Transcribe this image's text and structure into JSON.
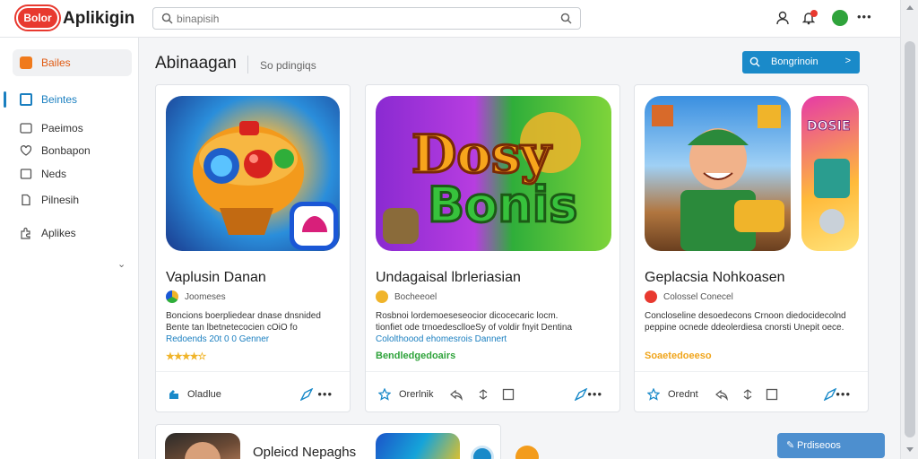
{
  "brand": {
    "badge": "Bolor",
    "name": "Aplikigin"
  },
  "search": {
    "placeholder": "binapisih",
    "value": ""
  },
  "sidebar": {
    "items": [
      {
        "label": "Bailes"
      },
      {
        "label": "Beintes"
      },
      {
        "label": "Paeimos"
      },
      {
        "label": "Bonbapon"
      },
      {
        "label": "Neds"
      },
      {
        "label": "Pilnesih"
      },
      {
        "label": "Aplikes"
      }
    ]
  },
  "header": {
    "title": "Abinaagan",
    "subtitle": "So pdingiqs"
  },
  "primary_button": {
    "label": "Bongrinoin",
    "arrow": ">"
  },
  "cards": [
    {
      "name": "Vaplusin Danan",
      "developer": "Joomeses",
      "desc_lines": [
        "Boncions boerpliedear dnase dnsnided",
        "Bente tan lbetnetecocien cOiO fo"
      ],
      "desc_highlight": "Redoends 20t 0 0 Genner",
      "status": "★★★★☆",
      "footer": "Oladlue"
    },
    {
      "name": "Undagaisal lbrleriasian",
      "developer": "Bocheeoel",
      "desc_lines": [
        "Rosbnoi lordemoeseseocior dicocecaric locm.",
        "tionfiet ode trnoedesclloeSy of voldir fnyit  Dentina"
      ],
      "desc_highlight": "Cololthoood ehomesrois  Dannert",
      "status": "Bendledgedoairs",
      "footer": "Orerlnik"
    },
    {
      "name": "Geplacsia Nohkoasen",
      "developer": "Colossel Conecel",
      "desc_lines": [
        "Concloseline desoedecons Crnoon diedocidecolnd",
        "peppine ocnede ddeolerdiesa cnorsti Unepit oece."
      ],
      "desc_highlight": "",
      "status": "Soaetedoeeso",
      "footer": "Orednt"
    }
  ],
  "bottom": {
    "card_name": "Opleicd Nepaghs",
    "float_label": "Prdiseoos"
  },
  "colors": {
    "accent": "#1a8ac9",
    "brand": "#e8392f",
    "green": "#2fa33b",
    "gold": "#f0b42a"
  }
}
